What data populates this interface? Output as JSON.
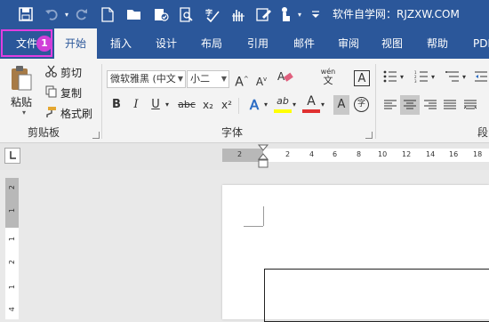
{
  "title": "软件自学网：RJZXW.COM",
  "quick_access": [
    {
      "icon": "save-icon"
    },
    {
      "icon": "undo-icon"
    },
    {
      "icon": "redo-icon"
    },
    {
      "icon": "new-document-icon"
    },
    {
      "icon": "open-folder-icon"
    },
    {
      "icon": "document-check-icon"
    },
    {
      "icon": "print-preview-icon"
    },
    {
      "icon": "spelling-icon"
    },
    {
      "icon": "touch-mode-icon"
    },
    {
      "icon": "edit-document-icon"
    },
    {
      "icon": "touch-hand-icon"
    },
    {
      "icon": "customize-dropdown-icon"
    }
  ],
  "tabs": {
    "file": "文件",
    "home": "开始",
    "insert": "插入",
    "design": "设计",
    "layout": "布局",
    "references": "引用",
    "mailings": "邮件",
    "review": "审阅",
    "view": "视图",
    "help": "帮助",
    "pdf": "PDF"
  },
  "step_badge": "1",
  "clipboard": {
    "paste": "粘贴",
    "cut": "剪切",
    "copy": "复制",
    "format_painter": "格式刷",
    "group_label": "剪贴板"
  },
  "font": {
    "font_name": "微软雅黑 (中文",
    "font_size": "小二",
    "phonetic": "wén",
    "char_border": "A",
    "bold": "B",
    "italic": "I",
    "underline": "U",
    "strikethrough": "abc",
    "subscript": "x₂",
    "superscript": "x²",
    "text_effects": "A",
    "highlight": "ab",
    "font_color": "A",
    "char_shading": "A",
    "enclose": "字",
    "group_label": "字体"
  },
  "paragraph": {
    "group_label": "段"
  },
  "ruler": {
    "h_ticks": [
      "2",
      "2",
      "4",
      "6",
      "8",
      "10",
      "12",
      "14",
      "16",
      "18"
    ],
    "v_ticks": [
      "2",
      "1",
      "1",
      "2",
      "1",
      "4"
    ]
  },
  "colors": {
    "accent": "#2b579a",
    "highlight_box": "#e23ee0",
    "badge": "#d03fd8",
    "font_color_red": "#e03030",
    "highlight_yellow": "#ffff00"
  }
}
